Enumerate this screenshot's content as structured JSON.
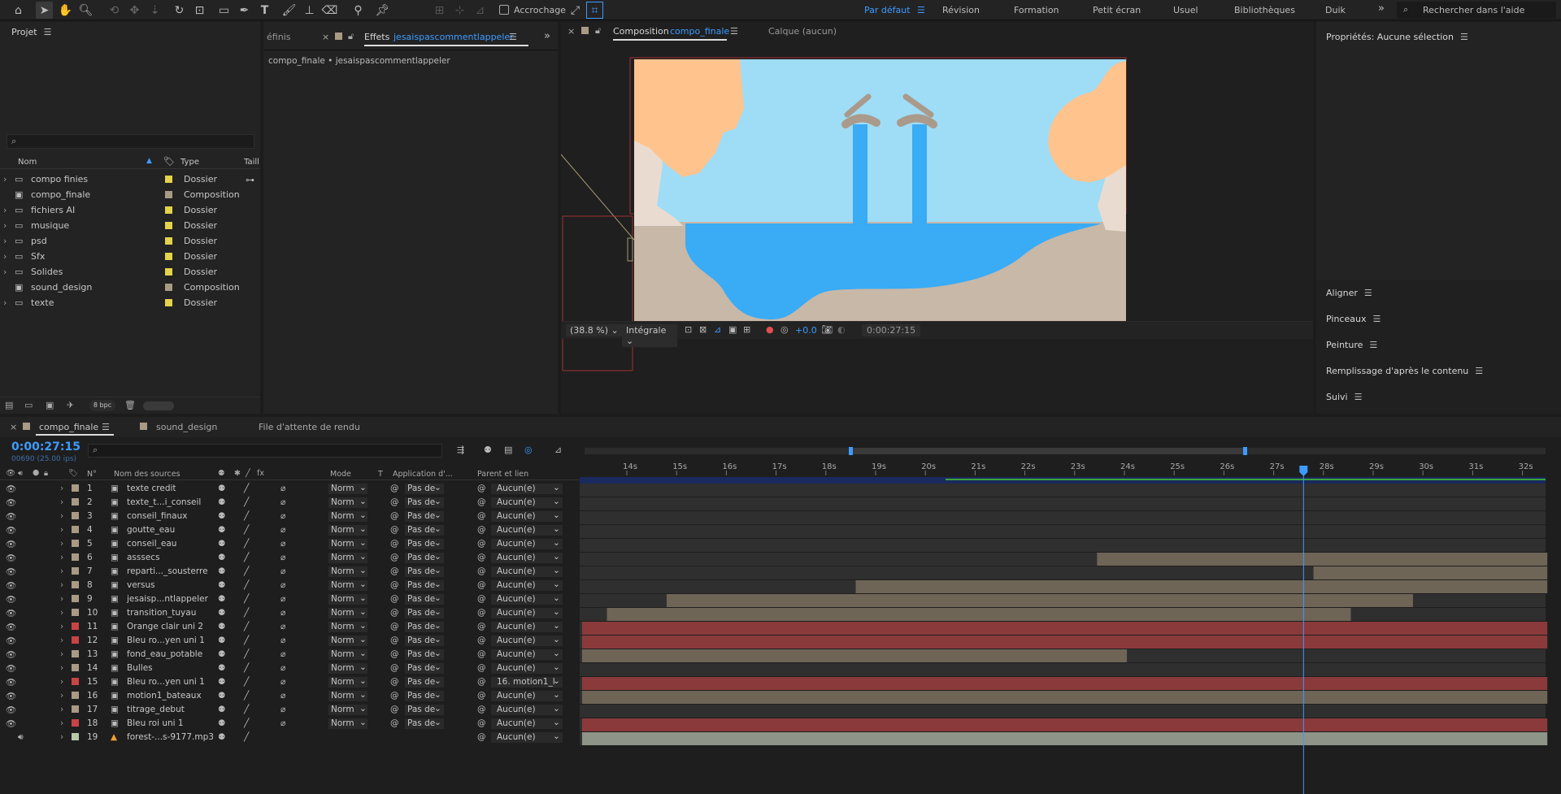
{
  "toolbar": {
    "snapping_label": "Accrochage",
    "workspaces": [
      {
        "label": "Par défaut",
        "active": true
      },
      {
        "label": "Révision"
      },
      {
        "label": "Formation"
      },
      {
        "label": "Petit écran"
      },
      {
        "label": "Usuel"
      },
      {
        "label": "Bibliothèques"
      },
      {
        "label": "Duik"
      }
    ],
    "overflow": "»",
    "search_placeholder": "Rechercher dans l'aide"
  },
  "project": {
    "title": "Projet",
    "search_placeholder": "",
    "columns": {
      "name": "Nom",
      "type": "Type",
      "size": "Taill"
    },
    "items": [
      {
        "name": "compo finies",
        "type": "Dossier",
        "kind": "folder",
        "color": "#e5d34a"
      },
      {
        "name": "compo_finale",
        "type": "Composition",
        "kind": "comp",
        "color": "#a99a84"
      },
      {
        "name": "fichiers AI",
        "type": "Dossier",
        "kind": "folder",
        "color": "#e5d34a"
      },
      {
        "name": "musique",
        "type": "Dossier",
        "kind": "folder",
        "color": "#e5d34a"
      },
      {
        "name": "psd",
        "type": "Dossier",
        "kind": "folder",
        "color": "#e5d34a"
      },
      {
        "name": "Sfx",
        "type": "Dossier",
        "kind": "folder",
        "color": "#e5d34a"
      },
      {
        "name": "Solides",
        "type": "Dossier",
        "kind": "folder",
        "color": "#e5d34a"
      },
      {
        "name": "sound_design",
        "type": "Composition",
        "kind": "comp",
        "color": "#a99a84"
      },
      {
        "name": "texte",
        "type": "Dossier",
        "kind": "folder",
        "color": "#e5d34a"
      }
    ],
    "bpc": "8 bpc"
  },
  "effects": {
    "tab_prev": "éfinis",
    "tab_label": "Effets",
    "tab_layer": "jesaispascommentlappeler",
    "breadcrumb": "compo_finale • jesaispascommentlappeler"
  },
  "composition": {
    "tab_label": "Composition",
    "comp_name": "compo_finale",
    "layer_tab": "Calque",
    "layer_value": "(aucun)",
    "zoom": "(38.8 %)",
    "resolution": "Intégrale",
    "exposure": "+0.0",
    "timecode": "0:00:27:15"
  },
  "right_panel": {
    "properties_title": "Propriétés: Aucune sélection",
    "sections": [
      "Aligner",
      "Pinceaux",
      "Peinture",
      "Remplissage d'après le contenu",
      "Suivi"
    ]
  },
  "timeline": {
    "tabs": [
      {
        "label": "compo_finale",
        "active": true
      },
      {
        "label": "sound_design"
      },
      {
        "label": "File d'attente de rendu"
      }
    ],
    "current_time": "0:00:27:15",
    "frame_info": "00690 (25.00 ips)",
    "columns": {
      "num": "N°",
      "source": "Nom des sources",
      "mode": "Mode",
      "t": "T",
      "track": "Application d'...",
      "parent": "Parent et lien"
    },
    "ruler": [
      "14s",
      "15s",
      "16s",
      "17s",
      "18s",
      "19s",
      "20s",
      "21s",
      "22s",
      "23s",
      "24s",
      "25s",
      "26s",
      "27s",
      "28s",
      "29s",
      "30s",
      "31s",
      "32s"
    ],
    "layers": [
      {
        "num": "1",
        "name": "texte credit",
        "label": "#a99a84",
        "mode": "Norm",
        "track": "Pas de",
        "parent": "Aucun(e)",
        "bar_start": null,
        "bar_end": null,
        "bar_color": null
      },
      {
        "num": "2",
        "name": "texte_t...i_conseil",
        "label": "#a99a84",
        "mode": "Norm",
        "track": "Pas de",
        "parent": "Aucun(e)",
        "bar_start": null,
        "bar_end": null,
        "bar_color": null
      },
      {
        "num": "3",
        "name": "conseil_finaux",
        "label": "#a99a84",
        "mode": "Norm",
        "track": "Pas de",
        "parent": "Aucun(e)",
        "bar_start": null,
        "bar_end": null,
        "bar_color": null
      },
      {
        "num": "4",
        "name": "goutte_eau",
        "label": "#a99a84",
        "mode": "Norm",
        "track": "Pas de",
        "parent": "Aucun(e)",
        "bar_start": null,
        "bar_end": null,
        "bar_color": null
      },
      {
        "num": "5",
        "name": "conseil_eau",
        "label": "#a99a84",
        "mode": "Norm",
        "track": "Pas de",
        "parent": "Aucun(e)",
        "bar_start": null,
        "bar_end": null,
        "bar_color": null
      },
      {
        "num": "6",
        "name": "asssecs",
        "label": "#a99a84",
        "mode": "Norm",
        "track": "Pas de",
        "parent": "Aucun(e)",
        "bar_start": 23.45,
        "bar_end": 32.5,
        "bar_color": "#6e6557"
      },
      {
        "num": "7",
        "name": "reparti..._sousterre",
        "label": "#a99a84",
        "mode": "Norm",
        "track": "Pas de",
        "parent": "Aucun(e)",
        "bar_start": 27.8,
        "bar_end": 32.5,
        "bar_color": "#6e6557"
      },
      {
        "num": "8",
        "name": "versus",
        "label": "#a99a84",
        "mode": "Norm",
        "track": "Pas de",
        "parent": "Aucun(e)",
        "bar_start": 18.6,
        "bar_end": 32.5,
        "bar_color": "#6e6557"
      },
      {
        "num": "9",
        "name": "jesaisp...ntlappeler",
        "label": "#a99a84",
        "mode": "Norm",
        "track": "Pas de",
        "parent": "Aucun(e)",
        "bar_start": 14.8,
        "bar_end": 29.8,
        "bar_color": "#6e6557"
      },
      {
        "num": "10",
        "name": "transition_tuyau",
        "label": "#a99a84",
        "mode": "Norm",
        "track": "Pas de",
        "parent": "Aucun(e)",
        "bar_start": 13.6,
        "bar_end": 28.55,
        "bar_color": "#6e6557"
      },
      {
        "num": "11",
        "name": "Orange clair uni 2",
        "label": "#c84444",
        "mode": "Norm",
        "track": "Pas de",
        "parent": "Aucun(e)",
        "bar_start": 13.1,
        "bar_end": 32.5,
        "bar_color": "#8a3a3a"
      },
      {
        "num": "12",
        "name": "Bleu ro...yen uni 1",
        "label": "#c84444",
        "mode": "Norm",
        "track": "Pas de",
        "parent": "Aucun(e)",
        "bar_start": 13.1,
        "bar_end": 32.5,
        "bar_color": "#8a3a3a"
      },
      {
        "num": "13",
        "name": "fond_eau_potable",
        "label": "#a99a84",
        "mode": "Norm",
        "track": "Pas de",
        "parent": "Aucun(e)",
        "bar_start": 13.1,
        "bar_end": 24.05,
        "bar_color": "#6e6557"
      },
      {
        "num": "14",
        "name": "Bulles",
        "label": "#a99a84",
        "mode": "Norm",
        "track": "Pas de",
        "parent": "Aucun(e)",
        "bar_start": null,
        "bar_end": null,
        "bar_color": null
      },
      {
        "num": "15",
        "name": "Bleu ro...yen uni 1",
        "label": "#c84444",
        "mode": "Norm",
        "track": "Pas de",
        "parent": "16. motion1_l",
        "bar_start": 13.1,
        "bar_end": 32.5,
        "bar_color": "#8a3a3a"
      },
      {
        "num": "16",
        "name": "motion1_bateaux",
        "label": "#a99a84",
        "mode": "Norm",
        "track": "Pas de",
        "parent": "Aucun(e)",
        "bar_start": 13.1,
        "bar_end": 32.5,
        "bar_color": "#6e6557"
      },
      {
        "num": "17",
        "name": "titrage_debut",
        "label": "#a99a84",
        "mode": "Norm",
        "track": "Pas de",
        "parent": "Aucun(e)",
        "bar_start": null,
        "bar_end": null,
        "bar_color": null
      },
      {
        "num": "18",
        "name": "Bleu roi uni 1",
        "label": "#c84444",
        "mode": "Norm",
        "track": "Pas de",
        "parent": "Aucun(e)",
        "bar_start": 13.1,
        "bar_end": 32.5,
        "bar_color": "#8a3a3a"
      },
      {
        "num": "19",
        "name": "forest-...s-9177.mp3",
        "label": "#b5c9a8",
        "mode": "",
        "track": "",
        "parent": "Aucun(e)",
        "bar_start": 13.1,
        "bar_end": 32.5,
        "bar_color": "#8e9487"
      }
    ]
  },
  "colors": {
    "accent": "#3d9bff",
    "sky": "#9fdcf6",
    "water": "#3aabf5",
    "ground": "#c8b8a8",
    "foliage": "#ffc38e",
    "trunk": "#eadbd0",
    "pipe_cap": "#a99a8b"
  }
}
